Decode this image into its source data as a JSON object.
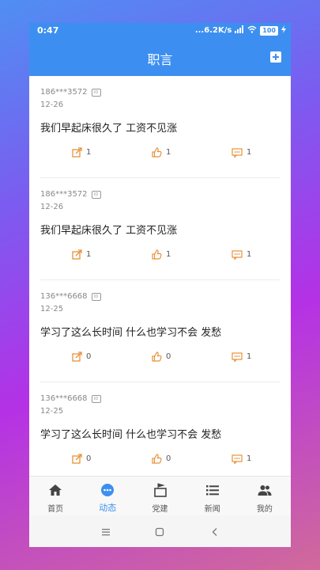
{
  "status_bar": {
    "time": "0:47",
    "network_speed": "...6.2K/s",
    "battery": "100"
  },
  "app_bar": {
    "title": "职言",
    "add_icon": "plus-square-icon"
  },
  "posts": [
    {
      "user": "186***3572",
      "date": "12-26",
      "content": "我们早起床很久了 工资不见涨",
      "shares": "1",
      "likes": "1",
      "comments": "1"
    },
    {
      "user": "186***3572",
      "date": "12-26",
      "content": "我们早起床很久了 工资不见涨",
      "shares": "1",
      "likes": "1",
      "comments": "1"
    },
    {
      "user": "136***6668",
      "date": "12-25",
      "content": "学习了这么长时间 什么也学习不会 发愁",
      "shares": "0",
      "likes": "0",
      "comments": "1"
    },
    {
      "user": "136***6668",
      "date": "12-25",
      "content": "学习了这么长时间 什么也学习不会 发愁",
      "shares": "0",
      "likes": "0",
      "comments": "1"
    }
  ],
  "tabs": [
    {
      "label": "首页",
      "icon": "home-icon"
    },
    {
      "label": "动态",
      "icon": "chat-bubble-icon",
      "active": true
    },
    {
      "label": "党建",
      "icon": "flag-icon"
    },
    {
      "label": "新闻",
      "icon": "list-icon"
    },
    {
      "label": "我的",
      "icon": "people-icon"
    }
  ],
  "colors": {
    "primary": "#3c8ff0",
    "action_icon": "#e8913a"
  }
}
